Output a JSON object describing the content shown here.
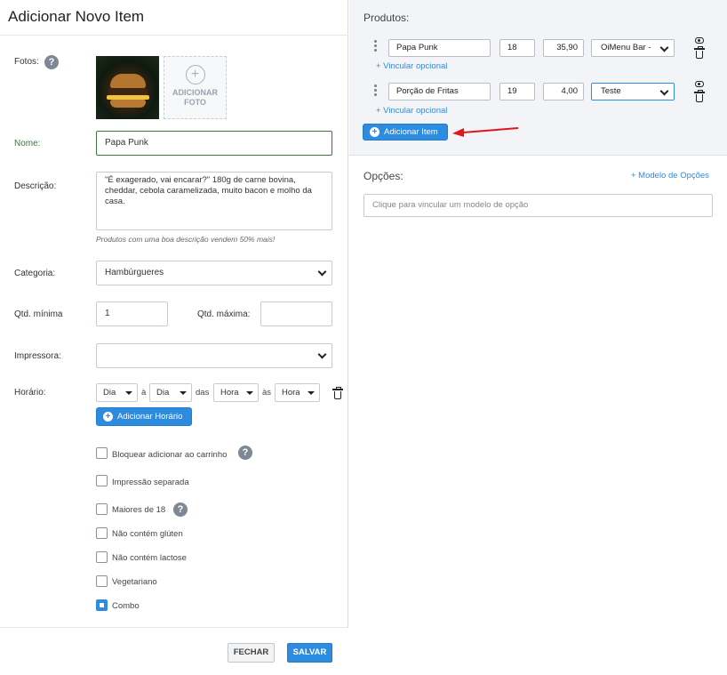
{
  "form": {
    "title": "Adicionar Novo Item",
    "fotos_label": "Fotos:",
    "add_photo_label": "ADICIONAR FOTO",
    "nome_label": "Nome:",
    "nome_value": "Papa Punk",
    "descricao_label": "Descrição:",
    "descricao_value": "\"É exagerado, vai encarar?\" 180g de carne bovina, cheddar, cebola caramelizada, muito bacon e molho da casa.",
    "descricao_hint": "Produtos com uma boa descrição vendem 50% mais!",
    "categoria_label": "Categoria:",
    "categoria_value": "Hambúrgueres",
    "qtd_minima_label": "Qtd. mínima",
    "qtd_minima_value": "1",
    "qtd_maxima_label": "Qtd. máxima:",
    "qtd_maxima_value": "",
    "impressora_label": "Impressora:",
    "impressora_value": "",
    "horario_label": "Horário:",
    "horario": {
      "dia1": "Dia",
      "sep_a": "à",
      "dia2": "Dia",
      "sep_das": "das",
      "hora1": "Hora",
      "sep_as": "às",
      "hora2": "Hora"
    },
    "add_horario_label": "Adicionar Horário",
    "checkboxes": [
      {
        "label": "Bloquear adicionar ao carrinho",
        "checked": false
      },
      {
        "label": "Impressão separada",
        "checked": false
      },
      {
        "label": "Maiores de 18",
        "checked": false
      },
      {
        "label": "Não contém glúten",
        "checked": false
      },
      {
        "label": "Não contém lactose",
        "checked": false
      },
      {
        "label": "Vegetariano",
        "checked": false
      },
      {
        "label": "Combo",
        "checked": true
      }
    ],
    "fechar_label": "FECHAR",
    "salvar_label": "SALVAR"
  },
  "produtos": {
    "title": "Produtos:",
    "items": [
      {
        "nome": "Papa Punk",
        "qtd": "18",
        "preco": "35,90",
        "loja": "OiMenu Bar -",
        "vincular": "+ Vincular opcional"
      },
      {
        "nome": "Porção de Fritas",
        "qtd": "19",
        "preco": "4,00",
        "loja": "Teste",
        "vincular": "+ Vincular opcional"
      }
    ],
    "add_item_label": "Adicionar Item"
  },
  "opcoes": {
    "title": "Opções:",
    "modelo_link": "+ Modelo de Opções",
    "placeholder": "Clique para vincular um modelo de opção"
  },
  "colors": {
    "accent": "#2d8ce0",
    "arrow": "#e0171b",
    "success": "#3c763d"
  }
}
